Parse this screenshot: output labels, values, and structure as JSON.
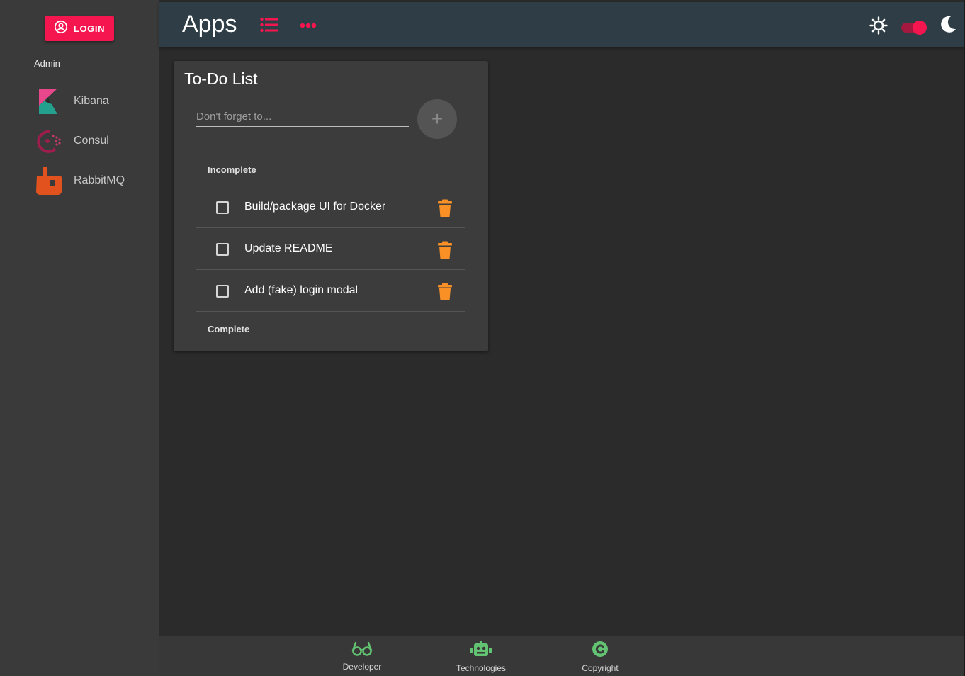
{
  "sidebar": {
    "login_label": "LOGIN",
    "admin_label": "Admin",
    "items": [
      {
        "label": "Kibana",
        "icon": "kibana-logo"
      },
      {
        "label": "Consul",
        "icon": "consul-logo"
      },
      {
        "label": "RabbitMQ",
        "icon": "rabbitmq-logo"
      }
    ]
  },
  "header": {
    "title": "Apps",
    "icons": [
      "list-icon",
      "more-horiz-icon",
      "sun-icon",
      "theme-toggle",
      "moon-icon"
    ],
    "dark_mode": true
  },
  "todo": {
    "title": "To-Do List",
    "input_placeholder": "Don't forget to...",
    "input_value": "",
    "add_symbol": "+",
    "incomplete_label": "Incomplete",
    "complete_label": "Complete",
    "items": [
      {
        "text": "Build/package UI for Docker",
        "checked": false
      },
      {
        "text": "Update README",
        "checked": false
      },
      {
        "text": "Add (fake) login modal",
        "checked": false
      }
    ]
  },
  "footer": {
    "items": [
      {
        "label": "Developer",
        "icon": "glasses-icon"
      },
      {
        "label": "Technologies",
        "icon": "robot-icon"
      },
      {
        "label": "Copyright",
        "icon": "copyright-icon"
      }
    ]
  },
  "colors": {
    "accent": "#f5164f",
    "trash": "#f99026",
    "footer_icon": "#62c472",
    "header_bg": "#2f3e46"
  }
}
